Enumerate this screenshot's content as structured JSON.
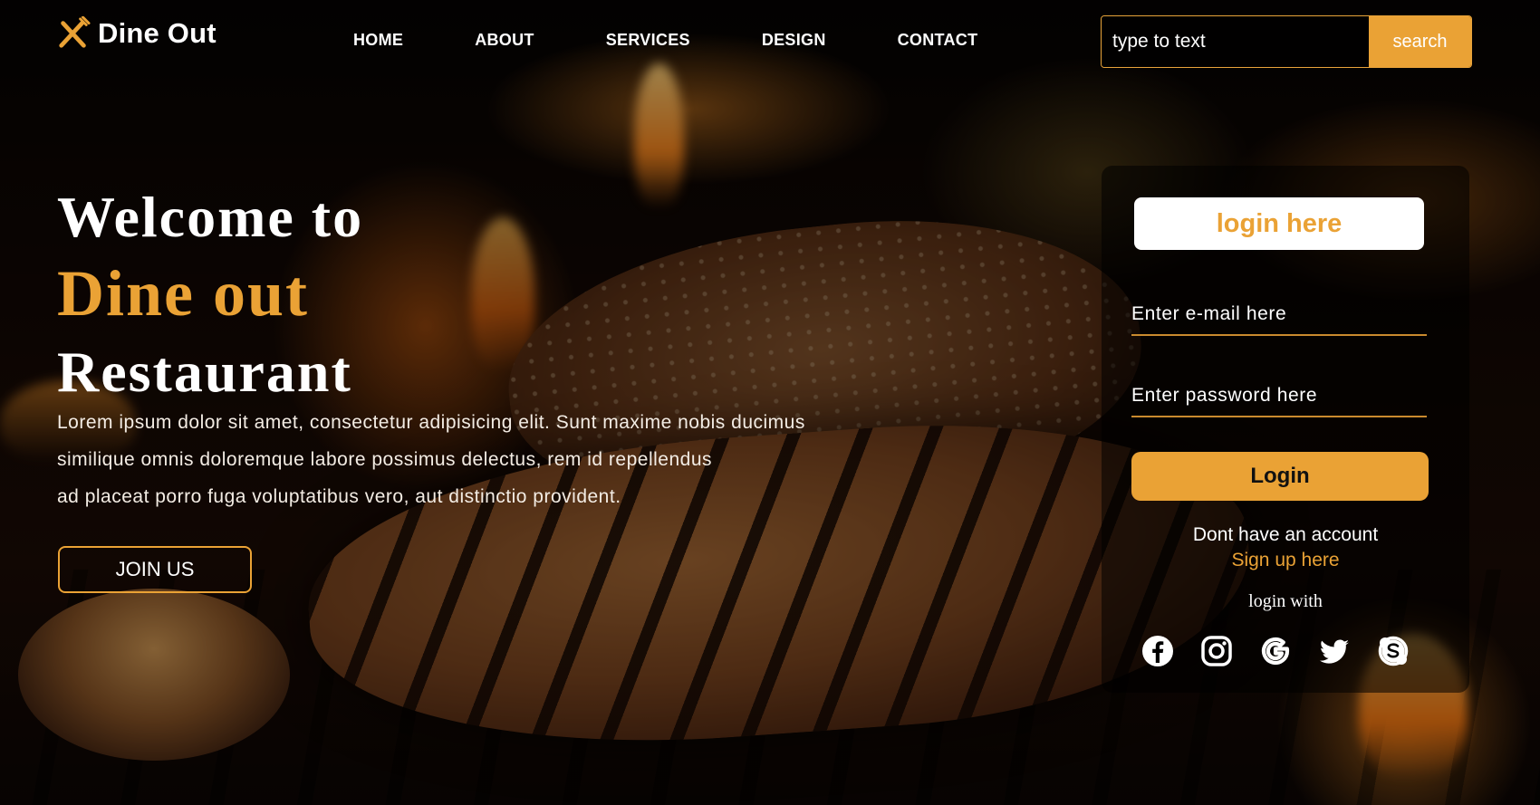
{
  "brand": {
    "name": "Dine Out",
    "icon": "fork-knife-icon"
  },
  "nav": {
    "items": [
      "HOME",
      "ABOUT",
      "SERVICES",
      "DESIGN",
      "CONTACT"
    ]
  },
  "search": {
    "placeholder": "type to text",
    "button_label": "search"
  },
  "hero": {
    "line1": "Welcome to",
    "line2": "Dine out",
    "line3": "Restaurant",
    "desc_lines": [
      "Lorem ipsum dolor sit amet, consectetur adipisicing elit. Sunt maxime nobis ducimus",
      "similique omnis doloremque labore possimus delectus, rem id repellendus",
      "ad placeat porro fuga voluptatibus vero, aut distinctio provident."
    ],
    "join_label": "JOIN US"
  },
  "login": {
    "heading": "login here",
    "email_placeholder": "Enter e-mail here",
    "password_placeholder": "Enter password here",
    "button_label": "Login",
    "no_account": "Dont have an account",
    "signup": "Sign up here",
    "login_with": "login with",
    "socials": [
      "facebook-icon",
      "instagram-icon",
      "google-icon",
      "twitter-icon",
      "skype-icon"
    ]
  },
  "colors": {
    "accent": "#eaa235",
    "text": "#ffffff",
    "card_bg": "#000000"
  }
}
